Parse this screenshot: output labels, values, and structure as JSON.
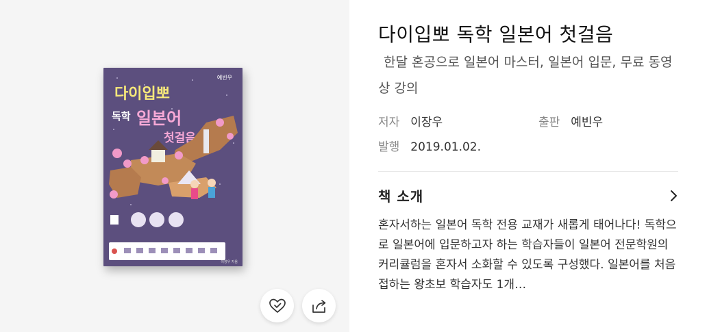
{
  "book": {
    "cover": {
      "publisher_logo": "예빈우",
      "title_line1": "다이입뽀",
      "title_line2_a": "독학",
      "title_line2_b": "일본어",
      "title_line3": "첫걸음",
      "author_small": "이장우 지음"
    },
    "title": "다이입뽀 독학 일본어 첫걸음",
    "subtitle": "한달 혼공으로 일본어 마스터, 일본어 입문, 무료 동영상 강의",
    "meta": {
      "author_label": "저자",
      "author": "이장우",
      "publisher_label": "출판",
      "publisher": "예빈우",
      "date_label": "발행",
      "date": "2019.01.02."
    },
    "intro": {
      "heading": "책 소개",
      "text": "혼자서하는 일본어 독학 전용 교재가 새롭게 태어나다! 독학으로 일본어에 입문하고자 하는 학습자들이 일본어 전문학원의 커리큘럼을 혼자서 소화할 수 있도록 구성했다. 일본어를 처음 접하는 왕초보 학습자도 1개…"
    }
  },
  "actions": {
    "like_icon": "heart-check-icon",
    "share_icon": "share-icon"
  }
}
